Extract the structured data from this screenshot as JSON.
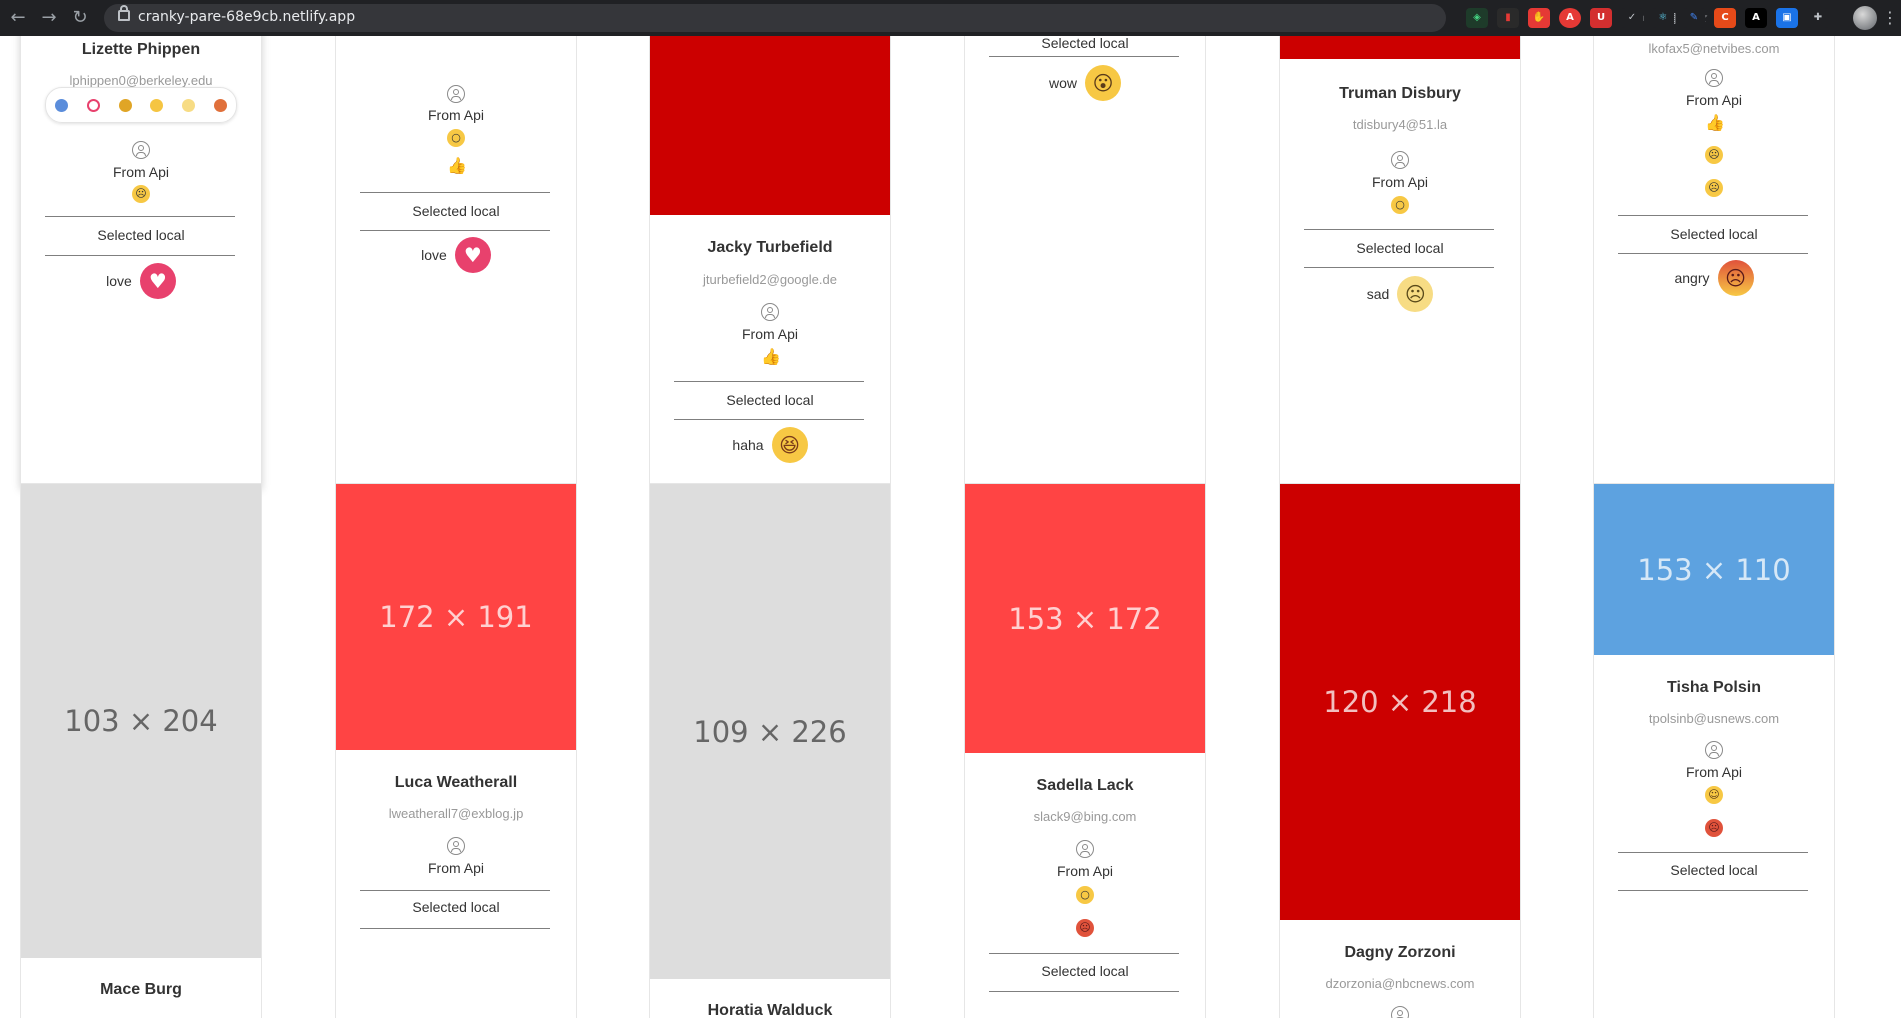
{
  "browser": {
    "url": "cranky-pare-68e9cb.netlify.app"
  },
  "labels": {
    "from_api": "From Api",
    "selected_local": "Selected local"
  },
  "cards": {
    "lizette": {
      "name": "Lizette Phippen",
      "email": "lphippen0@berkeley.edu",
      "reaction": "love",
      "api_emojis": [
        "sad"
      ]
    },
    "card2": {
      "reaction": "love",
      "api_emojis": [
        "wow",
        "like"
      ]
    },
    "jacky": {
      "name": "Jacky Turbefield",
      "email": "jturbefield2@google.de",
      "reaction": "haha",
      "api_emojis": [
        "like"
      ]
    },
    "card4": {
      "selected_label": "Selected local",
      "reaction": "wow"
    },
    "truman": {
      "name": "Truman Disbury",
      "email": "tdisbury4@51.la",
      "reaction": "sad",
      "api_emojis": [
        "wow"
      ]
    },
    "card6": {
      "email": "lkofax5@netvibes.com",
      "reaction": "angry",
      "api_emojis": [
        "like",
        "sad",
        "sad"
      ]
    },
    "mace": {
      "name": "Mace Burg",
      "image_label": "103 × 204"
    },
    "luca": {
      "name": "Luca Weatherall",
      "email": "lweatherall7@exblog.jp",
      "image_label": "172 × 191"
    },
    "horatia": {
      "name": "Horatia Walduck",
      "image_label": "109 × 226"
    },
    "sadella": {
      "name": "Sadella Lack",
      "email": "slack9@bing.com",
      "image_label": "153 × 172",
      "api_emojis": [
        "wow",
        "angry"
      ]
    },
    "dagny": {
      "name": "Dagny Zorzoni",
      "email": "dzorzonia@nbcnews.com",
      "image_label": "120 × 218"
    },
    "tisha": {
      "name": "Tisha Polsin",
      "email": "tpolsinb@usnews.com",
      "image_label": "153 × 110",
      "api_emojis": [
        "haha",
        "angry"
      ]
    }
  },
  "colors": {
    "red_dark": "#cc0000",
    "red_light": "#ff4444",
    "grey": "#dddddd",
    "blue": "#5da2e0",
    "love": "#e8416d",
    "emoji_yellow": "#f7c844",
    "angry": "#e0523b"
  }
}
